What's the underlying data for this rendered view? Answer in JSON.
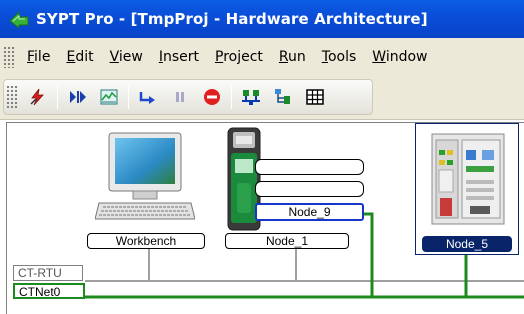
{
  "window": {
    "title": "SYPT Pro - [TmpProj - Hardware Architecture]"
  },
  "menu": {
    "items": [
      {
        "label": "File",
        "accel": "F",
        "rest": "ile"
      },
      {
        "label": "Edit",
        "accel": "E",
        "rest": "dit"
      },
      {
        "label": "View",
        "accel": "V",
        "rest": "iew"
      },
      {
        "label": "Insert",
        "accel": "I",
        "rest": "nsert"
      },
      {
        "label": "Project",
        "accel": "P",
        "rest": "roject"
      },
      {
        "label": "Run",
        "accel": "R",
        "rest": "un"
      },
      {
        "label": "Tools",
        "accel": "T",
        "rest": "ools"
      },
      {
        "label": "Window",
        "accel": "W",
        "rest": "indow"
      }
    ]
  },
  "toolbar": {
    "icons": [
      "lightning-icon",
      "step-into-icon",
      "monitor-graph-icon",
      "run-icon",
      "pause-icon",
      "stop-icon",
      "network-icon",
      "node-tree-icon",
      "grid-icon"
    ]
  },
  "diagram": {
    "workbench": {
      "label": "Workbench"
    },
    "node1": {
      "label": "Node_1",
      "subnode_label": "Node_9"
    },
    "node5": {
      "label": "Node_5"
    },
    "buses": {
      "ctrtu": "CT-RTU",
      "ctnet": "CTNet0"
    }
  },
  "colors": {
    "titlebar": "#0a4ed9",
    "ctnet_line": "#1d8a1d",
    "ctrtu_line": "#a0a0a0",
    "selection": "#0a246a",
    "active_border": "#1536c8"
  }
}
